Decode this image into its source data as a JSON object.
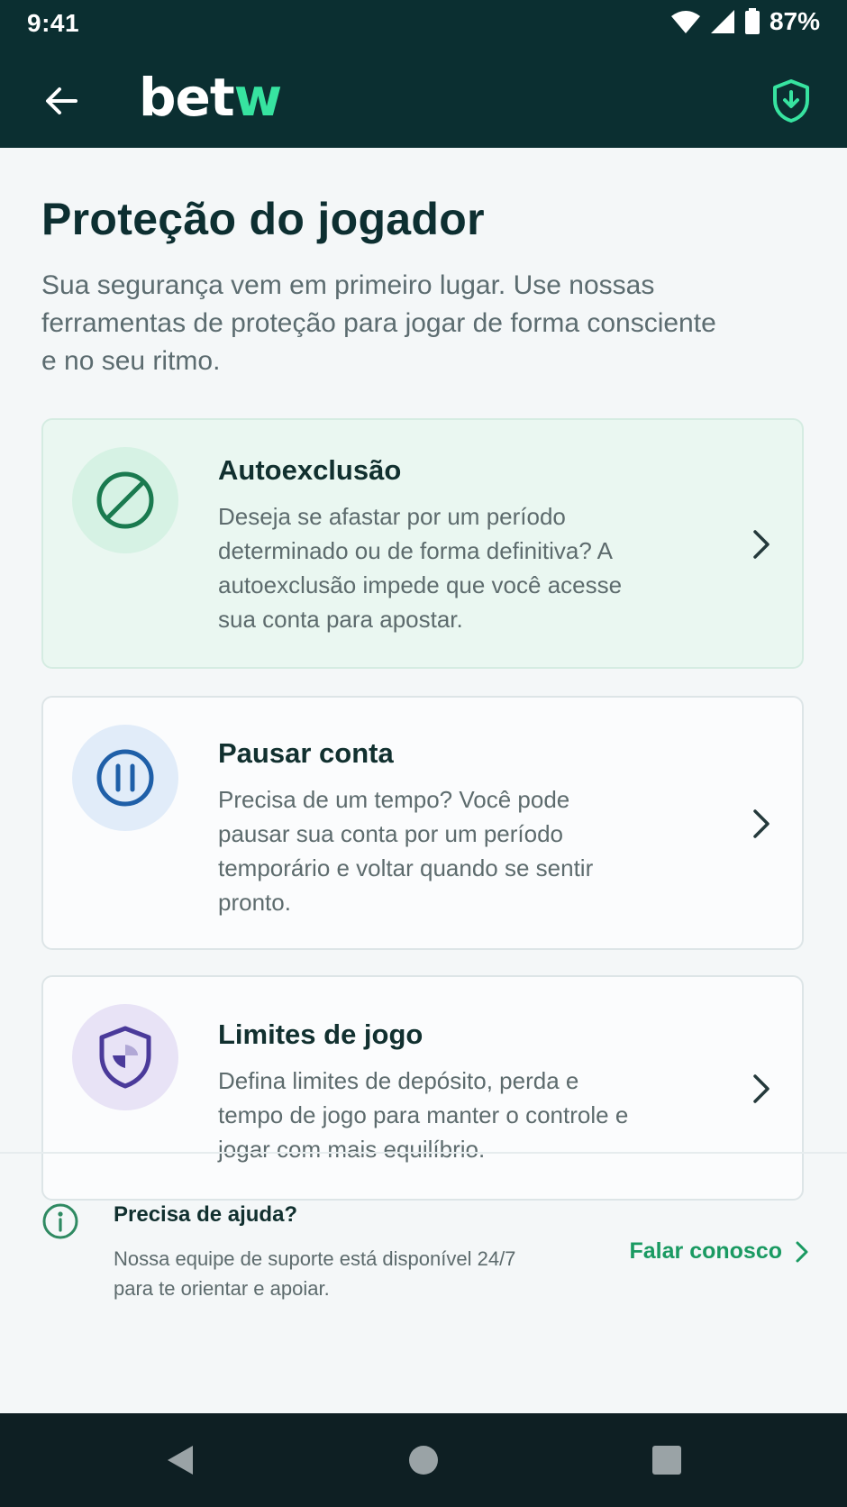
{
  "status_bar": {
    "time": "9:41",
    "battery": "87%"
  },
  "top_bar": {
    "logo_main": "bet",
    "logo_accent": "w"
  },
  "page": {
    "title": "Proteção do jogador",
    "subtitle": "Sua segurança vem em primeiro lugar. Use nossas ferramentas de proteção para jogar de forma consciente e no seu ritmo."
  },
  "cards": [
    {
      "title": "Autoexclusão",
      "description": "Deseja se afastar por um período determinado ou de forma definitiva? A autoexclusão impede que você acesse sua conta para apostar.",
      "icon": "ban-icon",
      "icon_color": "#1a7a4f",
      "icon_bg": "#d6f2e4"
    },
    {
      "title": "Pausar conta",
      "description": "Precisa de um tempo? Você pode pausar sua conta por um período temporário e voltar quando se sentir pronto.",
      "icon": "pause-icon",
      "icon_color": "#1f5fa8",
      "icon_bg": "#e1ecf9"
    },
    {
      "title": "Limites de jogo",
      "description": "Defina limites de depósito, perda e tempo de jogo para manter o controle e jogar com mais equilíbrio.",
      "icon": "shield-icon",
      "icon_color": "#4a3a9a",
      "icon_bg": "#e8e3f6"
    }
  ],
  "help": {
    "title": "Precisa de ajuda?",
    "text": "Nossa equipe de suporte está disponível 24/7 para te orientar e apoiar.",
    "link_label": "Falar conosco"
  },
  "colors": {
    "header_bg": "#0b2f31",
    "accent": "#37e3a0",
    "link": "#1a9a62"
  }
}
